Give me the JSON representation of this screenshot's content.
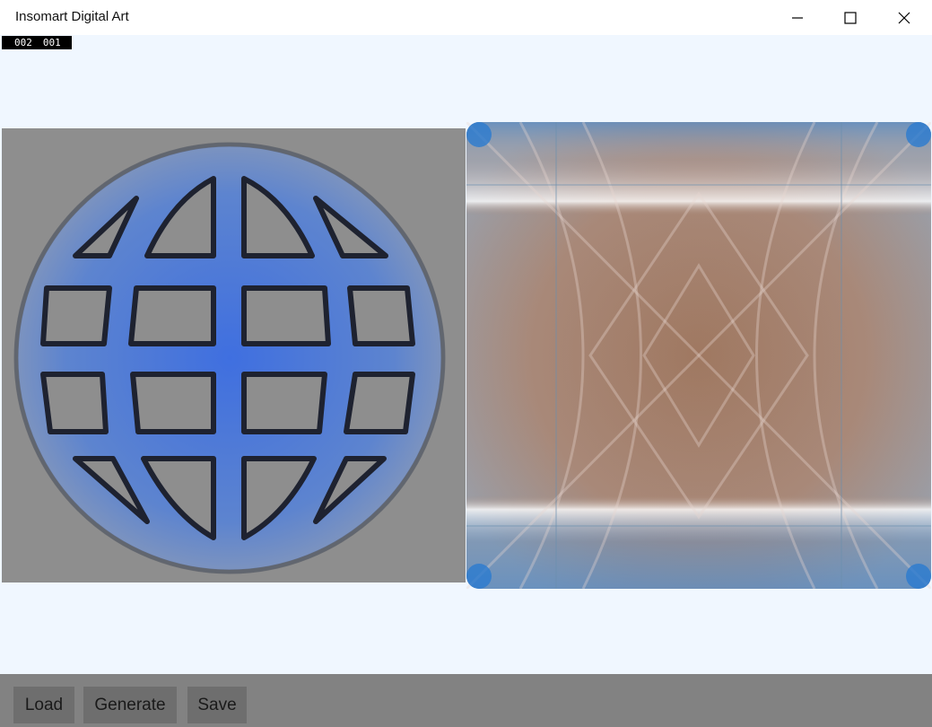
{
  "window": {
    "title": "Insomart Digital Art",
    "controls": [
      "minimize-icon",
      "maximize-icon",
      "close-icon"
    ]
  },
  "counter": {
    "first": "002",
    "second": "001"
  },
  "canvas": {
    "source_image": "globe-icon",
    "output_image": "generated-abstract-art"
  },
  "toolbar": {
    "load_label": "Load",
    "generate_label": "Generate",
    "save_label": "Save"
  },
  "colors": {
    "background": "#f0f7ff",
    "source_bg": "#8e8e8e",
    "globe_blue": "#4a78d8",
    "toolbar_bg": "#828282",
    "button_bg": "#6e6e6e"
  }
}
